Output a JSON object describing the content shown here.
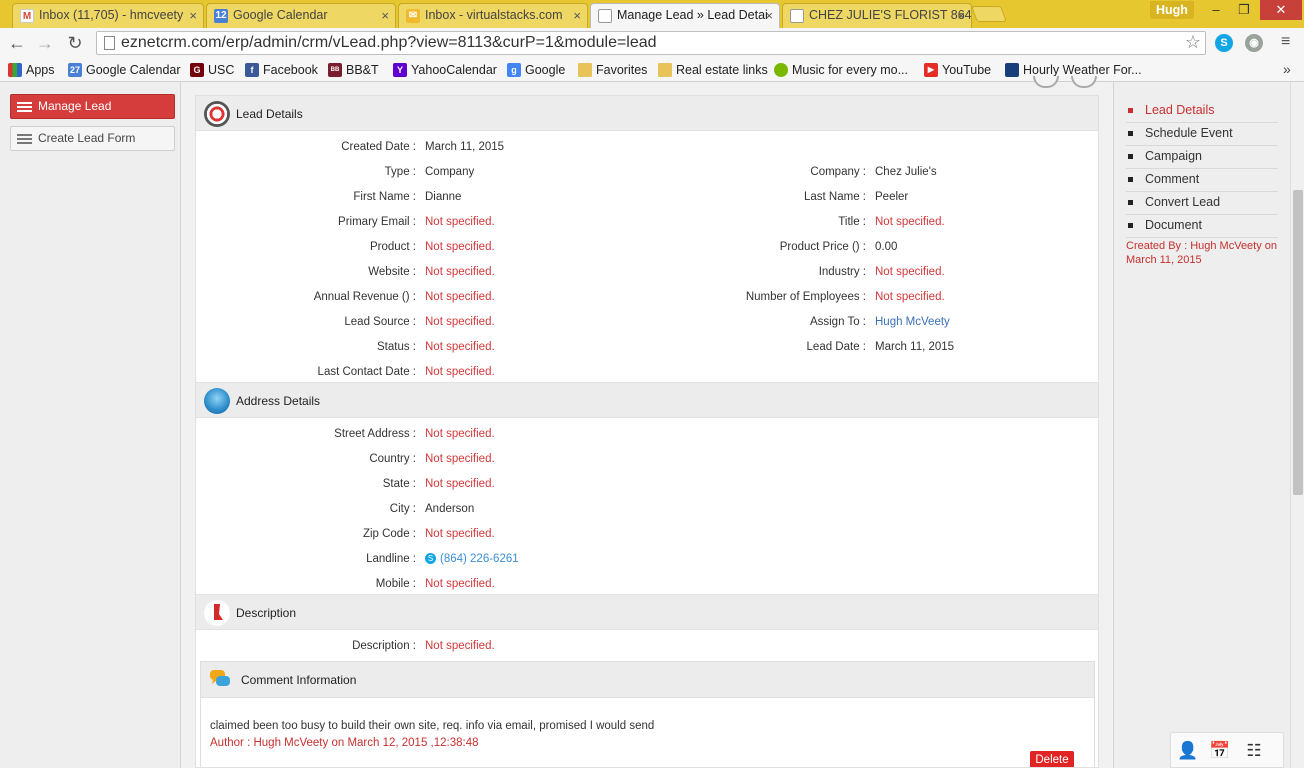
{
  "browser": {
    "tabs": [
      {
        "title": "Inbox (11,705) - hmcveety",
        "icon": "gmail-icon",
        "active": false
      },
      {
        "title": "Google Calendar",
        "icon": "calendar-icon",
        "active": false
      },
      {
        "title": "Inbox - virtualstacks.com",
        "icon": "mail-icon",
        "active": false
      },
      {
        "title": "Manage Lead » Lead Detai",
        "icon": "page-icon",
        "active": true
      },
      {
        "title": "CHEZ JULIE'S FLORIST 864",
        "icon": "page-icon",
        "active": false
      }
    ],
    "user_name": "Hugh",
    "url": "eznetcrm.com/erp/admin/crm/vLead.php?view=8113&curP=1&module=lead",
    "calendar_day": "12",
    "bookmarks": [
      {
        "label": "Apps",
        "icon": "apps-grid-icon"
      },
      {
        "label": "Google Calendar",
        "icon": "calendar-icon",
        "badge": "27"
      },
      {
        "label": "USC",
        "icon": "usc-icon"
      },
      {
        "label": "Facebook",
        "icon": "facebook-icon"
      },
      {
        "label": "BB&T",
        "icon": "bbt-icon"
      },
      {
        "label": "YahooCalendar",
        "icon": "yahoo-icon"
      },
      {
        "label": "Google",
        "icon": "google-icon"
      },
      {
        "label": "Favorites",
        "icon": "folder-icon"
      },
      {
        "label": "Real estate links",
        "icon": "folder-icon"
      },
      {
        "label": "Music for every mo...",
        "icon": "spotify-icon"
      },
      {
        "label": "YouTube",
        "icon": "youtube-icon"
      },
      {
        "label": "Hourly Weather For...",
        "icon": "weather-icon"
      }
    ],
    "more": "»"
  },
  "sidebar": {
    "manage_lead": "Manage Lead",
    "create_lead_form": "Create Lead Form"
  },
  "lead_details": {
    "title": "Lead Details",
    "left": [
      {
        "label": "Created Date :",
        "value": "March 11, 2015",
        "na": false
      },
      {
        "label": "Type :",
        "value": "Company",
        "na": false
      },
      {
        "label": "First Name :",
        "value": "Dianne",
        "na": false
      },
      {
        "label": "Primary Email :",
        "value": "Not specified.",
        "na": true
      },
      {
        "label": "Product :",
        "value": "Not specified.",
        "na": true
      },
      {
        "label": "Website :",
        "value": "Not specified.",
        "na": true
      },
      {
        "label": "Annual Revenue () :",
        "value": "Not specified.",
        "na": true
      },
      {
        "label": "Lead Source :",
        "value": "Not specified.",
        "na": true
      },
      {
        "label": "Status :",
        "value": "Not specified.",
        "na": true
      },
      {
        "label": "Last Contact Date :",
        "value": "Not specified.",
        "na": true
      }
    ],
    "right": [
      {
        "label": "Company :",
        "value": "Chez Julie's",
        "na": false
      },
      {
        "label": "Last Name :",
        "value": "Peeler",
        "na": false
      },
      {
        "label": "Title :",
        "value": "Not specified.",
        "na": true
      },
      {
        "label": "Product Price () :",
        "value": "0.00",
        "na": false
      },
      {
        "label": "Industry :",
        "value": "Not specified.",
        "na": true
      },
      {
        "label": "Number of Employees :",
        "value": "Not specified.",
        "na": true
      },
      {
        "label": "Assign To :",
        "value": "Hugh McVeety",
        "na": false,
        "link": true
      },
      {
        "label": "Lead Date :",
        "value": "March 11, 2015",
        "na": false
      }
    ]
  },
  "address_details": {
    "title": "Address Details",
    "rows": [
      {
        "label": "Street Address :",
        "value": "Not specified.",
        "na": true
      },
      {
        "label": "Country :",
        "value": "Not specified.",
        "na": true
      },
      {
        "label": "State :",
        "value": "Not specified.",
        "na": true
      },
      {
        "label": "City :",
        "value": "Anderson",
        "na": false
      },
      {
        "label": "Zip Code :",
        "value": "Not specified.",
        "na": true
      },
      {
        "label": "Landline :",
        "value": "(864) 226-6261",
        "na": false,
        "skype": true
      },
      {
        "label": "Mobile :",
        "value": "Not specified.",
        "na": true
      }
    ]
  },
  "description": {
    "title": "Description",
    "label": "Description :",
    "value": "Not specified."
  },
  "comments": {
    "title": "Comment Information",
    "text": "claimed been too busy to build their own site, req. info via email, promised I would send",
    "author": "Author : Hugh McVeety on March 12, 2015 ,12:38:48",
    "delete_label": "Delete"
  },
  "right_nav": {
    "items": [
      {
        "label": "Lead Details",
        "active": true
      },
      {
        "label": "Schedule Event",
        "active": false
      },
      {
        "label": "Campaign",
        "active": false
      },
      {
        "label": "Comment",
        "active": false
      },
      {
        "label": "Convert Lead",
        "active": false
      },
      {
        "label": "Document",
        "active": false
      }
    ],
    "created_by": "Created By : Hugh McVeety on March 11, 2015"
  },
  "colors": {
    "accent_red": "#d53c3c",
    "not_specified": "#d2383a",
    "link_blue": "#3b6fb6",
    "chrome_tabbar": "#e6c730"
  }
}
